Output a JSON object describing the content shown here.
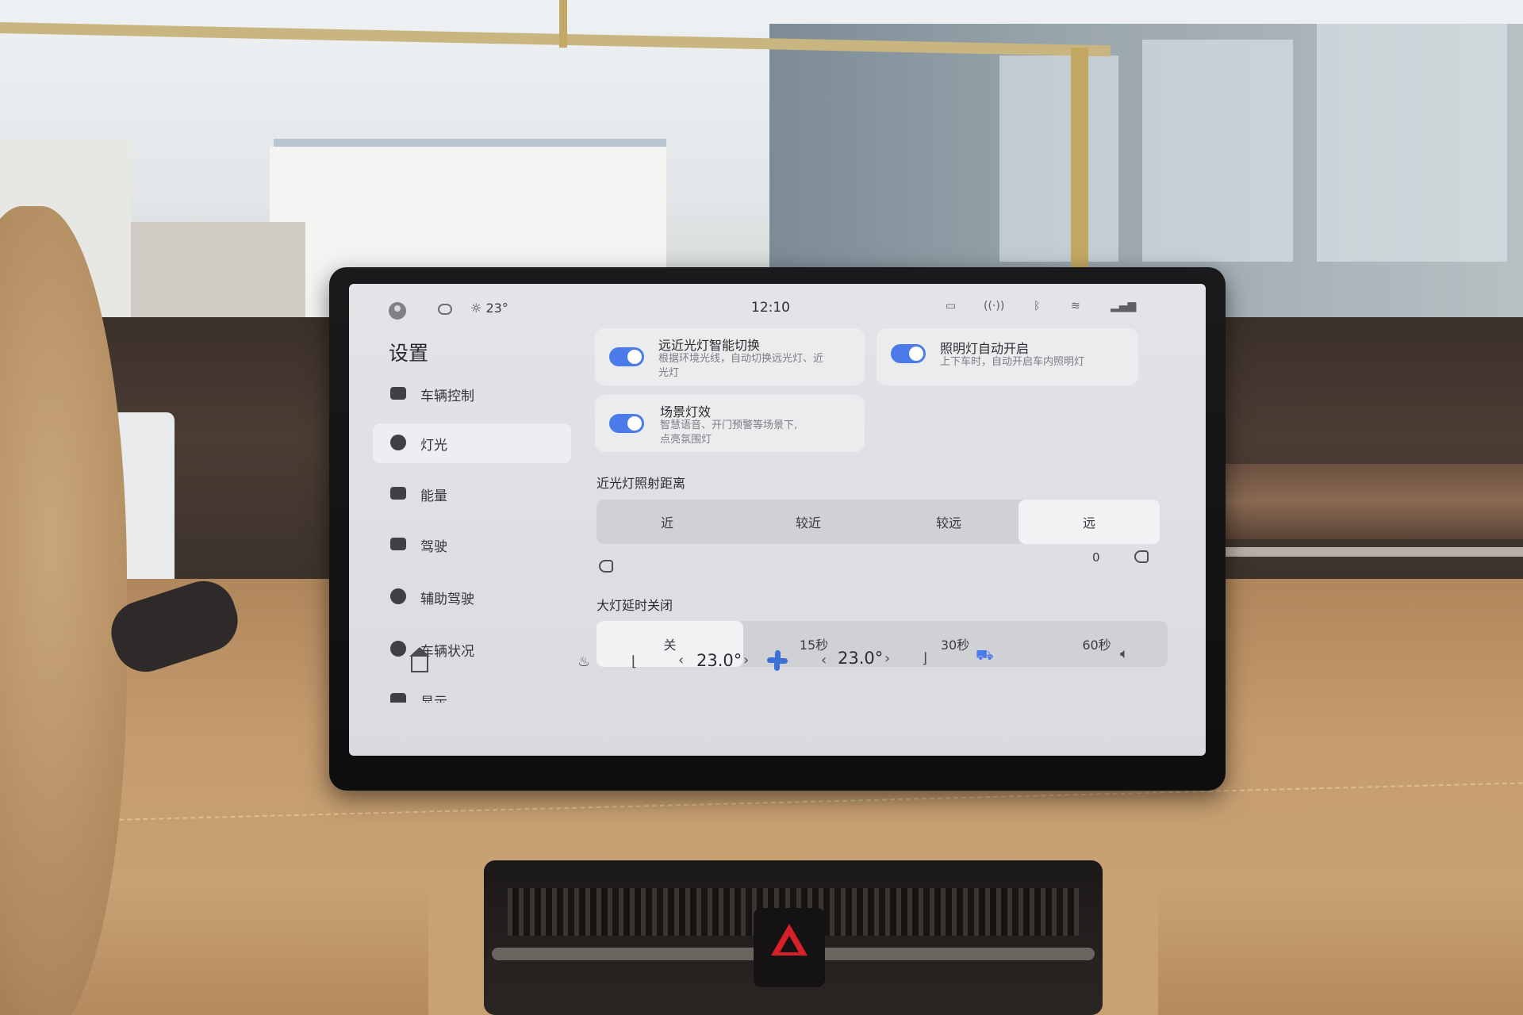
{
  "status_bar": {
    "weather_temp": "23°",
    "time": "12:10"
  },
  "sidebar": {
    "title": "设置",
    "items": [
      {
        "label": "车辆控制",
        "icon": "vehicle-control-icon"
      },
      {
        "label": "灯光",
        "icon": "light-icon",
        "active": true
      },
      {
        "label": "能量",
        "icon": "battery-icon"
      },
      {
        "label": "驾驶",
        "icon": "car-icon"
      },
      {
        "label": "辅助驾驶",
        "icon": "steering-wheel-icon"
      },
      {
        "label": "车辆状况",
        "icon": "vehicle-status-icon"
      },
      {
        "label": "显示",
        "icon": "display-icon"
      }
    ]
  },
  "cards": {
    "auto_high_beam": {
      "title": "远近光灯智能切换",
      "desc_line1": "根据环境光线，自动切换远光灯、近",
      "desc_line2": "光灯",
      "enabled": true
    },
    "interior_light": {
      "title": "照明灯自动开启",
      "desc": "上下车时，自动开启车内照明灯",
      "enabled": true
    },
    "scene_light": {
      "title": "场景灯效",
      "desc_line1": "智慧语音、开门预警等场景下,",
      "desc_line2": "点亮氛围灯",
      "enabled": true
    }
  },
  "low_beam_distance": {
    "title": "近光灯照射距离",
    "options": [
      "近",
      "较近",
      "较远",
      "远"
    ],
    "selected": "远",
    "value": "0"
  },
  "headlight_delay": {
    "title": "大灯延时关闭",
    "options": [
      "关",
      "15秒",
      "30秒",
      "60秒"
    ],
    "selected": "关"
  },
  "dock": {
    "left_temp": "23.0°",
    "right_temp": "23.0°",
    "left_arrow": "‹",
    "right_arrow": "›"
  },
  "colors": {
    "accent": "#4a7be8",
    "hazard": "#d8202a"
  }
}
